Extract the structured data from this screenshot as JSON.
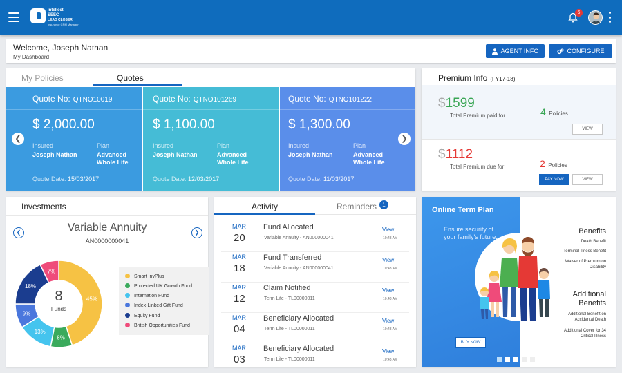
{
  "header": {
    "brand_line1": "intellect",
    "brand_line2": "SEEC",
    "brand_line3": "LEAD CLOSER",
    "brand_line4": "Insurance CRM Manager",
    "notification_count": "6"
  },
  "welcome": {
    "title": "Welcome, Joseph Nathan",
    "subtitle": "My Dashboard",
    "agent_info_label": "AGENT INFO",
    "configure_label": "CONFIGURE"
  },
  "policy_tabs": {
    "tab_policies": "My Policies",
    "tab_quotes": "Quotes"
  },
  "quotes": [
    {
      "label": "Quote No:",
      "number": "QTNO10019",
      "amount": "$ 2,000.00",
      "insured_label": "Insured",
      "insured": "Joseph Nathan",
      "plan_label": "Plan",
      "plan_line1": "Advanced",
      "plan_line2": "Whole Life",
      "date_label": "Quote Date:",
      "date": "15/03/2017",
      "color": "#3b9be0"
    },
    {
      "label": "Quote No:",
      "number": "QTNO101269",
      "amount": "$ 1,100.00",
      "insured_label": "Insured",
      "insured": "Joseph Nathan",
      "plan_label": "Plan",
      "plan_line1": "Advanced",
      "plan_line2": "Whole Life",
      "date_label": "Quote Date:",
      "date": "12/03/2017",
      "color": "#45bcd6"
    },
    {
      "label": "Quote No:",
      "number": "QTNO101222",
      "amount": "$ 1,300.00",
      "insured_label": "Insured",
      "insured": "Joseph Nathan",
      "plan_label": "Plan",
      "plan_line1": "Advanced",
      "plan_line2": "Whole Life",
      "date_label": "Quote Date:",
      "date": "11/03/2017",
      "color": "#5a8eea"
    }
  ],
  "premium": {
    "title": "Premium Info",
    "fy": "(FY17-18)",
    "paid_amount": "1599",
    "paid_label": "Total Premium paid for",
    "paid_policies_count": "4",
    "paid_policies_label": "Policies",
    "view_label": "VIEW",
    "due_amount": "1112",
    "due_label": "Total Premium due for",
    "due_policies_count": "2",
    "due_policies_label": "Policies",
    "pay_now_label": "PAY NOW",
    "view_label2": "VIEW",
    "dollar": "$"
  },
  "investments": {
    "title": "Investments",
    "product": "Variable Annuity",
    "account": "AN0000000041",
    "funds_count": "8",
    "funds_label": "Funds",
    "legend": [
      {
        "name": "Smart InvPlus",
        "color": "#f6c244"
      },
      {
        "name": "Protected UK Growth Fund",
        "color": "#3aaa5c"
      },
      {
        "name": "Internation Fund",
        "color": "#45c4ee"
      },
      {
        "name": "Index-Linked  Gift Fund",
        "color": "#4a77dd"
      },
      {
        "name": "Equity Fund",
        "color": "#1b3d8f"
      },
      {
        "name": "British Opportunities Fund",
        "color": "#ef4b7a"
      }
    ],
    "donut": [
      {
        "name": "Smart InvPlus",
        "value": 45,
        "label": "45%",
        "color": "#f6c244"
      },
      {
        "name": "Protected UK Growth Fund",
        "value": 8,
        "label": "8%",
        "color": "#3aaa5c"
      },
      {
        "name": "Internation Fund",
        "value": 13,
        "label": "13%",
        "color": "#45c4ee"
      },
      {
        "name": "Index-Linked  Gift Fund",
        "value": 9,
        "label": "9%",
        "color": "#4a77dd"
      },
      {
        "name": "Equity Fund",
        "value": 18,
        "label": "18%",
        "color": "#1b3d8f"
      },
      {
        "name": "British Opportunities Fund",
        "value": 7,
        "label": "7%",
        "color": "#ef4b7a"
      }
    ]
  },
  "activity": {
    "tab_activity": "Activity",
    "tab_reminders": "Reminders",
    "reminders_count": "1",
    "items": [
      {
        "month": "MAR",
        "day": "20",
        "title": "Fund Allocated",
        "sub": "Variable Annuity - AN000000041",
        "link": "View",
        "time": "10:48 AM"
      },
      {
        "month": "MAR",
        "day": "18",
        "title": "Fund Transferred",
        "sub": "Variable Annuity - AN000000041",
        "link": "View",
        "time": "10:48 AM"
      },
      {
        "month": "MAR",
        "day": "12",
        "title": "Claim Notified",
        "sub": "Term Life - TL00000011",
        "link": "View",
        "time": "10:48 AM"
      },
      {
        "month": "MAR",
        "day": "04",
        "title": "Beneficiary Allocated",
        "sub": "Term Life - TL00000011",
        "link": "View",
        "time": "10:48 AM"
      },
      {
        "month": "MAR",
        "day": "03",
        "title": "Beneficiary Allocated",
        "sub": "Term Life - TL00000011",
        "link": "View",
        "time": "10:48 AM"
      }
    ]
  },
  "promo": {
    "title": "Online Term Plan",
    "tagline": "Ensure security of your family's future.",
    "buy_label": "BUY NOW",
    "benefits_title": "Benefits",
    "benefits": [
      "Death Benefit",
      "Terminal Illness Benefit",
      "Waiver of Premium on Disability"
    ],
    "additional_title_1": "Additional",
    "additional_title_2": "Benefits",
    "additional": [
      "Additional Benefit on Accidental Death",
      "Additional Cover for 34 Critical Illness"
    ]
  }
}
